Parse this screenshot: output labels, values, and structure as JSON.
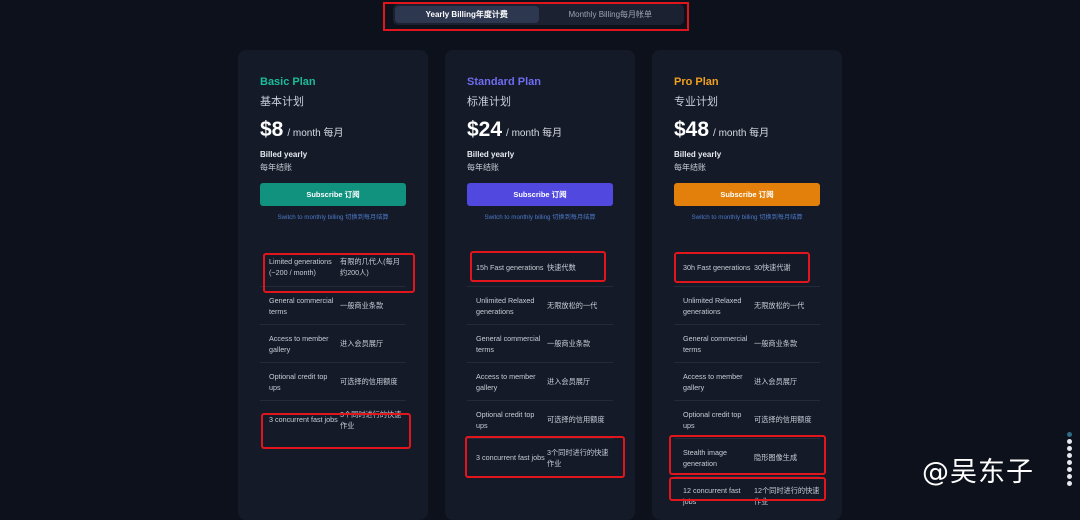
{
  "billing_toggle": {
    "yearly_label": "Yearly Billing年度计费",
    "monthly_label": "Monthly Billing每月帐单"
  },
  "plans": [
    {
      "name": "Basic Plan",
      "name_cn": "基本计划",
      "accent": "#1cbb9a",
      "price": "$8",
      "per": "/ month 每月",
      "billed": "Billed yearly",
      "billed_cn": "每年结账",
      "subscribe_label": "Subscribe 订阅",
      "button_color": "#11927f",
      "switch_label": "Switch to monthly billing 切换到每月结算",
      "features": [
        {
          "en": "Limited generations (~200 / month)",
          "cn": "有限的几代人(每月约200人)"
        },
        {
          "en": "General commercial terms",
          "cn": "一般商业条款"
        },
        {
          "en": "Access to member gallery",
          "cn": "进入会员展厅"
        },
        {
          "en": "Optional credit top ups",
          "cn": "可选择的信用额度"
        },
        {
          "en": "3 concurrent fast jobs",
          "cn": "3个同时进行的快速作业"
        }
      ]
    },
    {
      "name": "Standard Plan",
      "name_cn": "标准计划",
      "accent": "#6e6cf0",
      "price": "$24",
      "per": "/ month 每月",
      "billed": "Billed yearly",
      "billed_cn": "每年结账",
      "subscribe_label": "Subscribe 订阅",
      "button_color": "#5148e0",
      "switch_label": "Switch to monthly billing 切换到每月结算",
      "features": [
        {
          "en": "15h Fast generations",
          "cn": "快速代数"
        },
        {
          "en": "Unlimited Relaxed generations",
          "cn": "无限放松的一代"
        },
        {
          "en": "General commercial terms",
          "cn": "一般商业条款"
        },
        {
          "en": "Access to member gallery",
          "cn": "进入会员展厅"
        },
        {
          "en": "Optional credit top ups",
          "cn": "可选择的信用额度"
        },
        {
          "en": "3 concurrent fast jobs",
          "cn": "3个同时进行的快速作业"
        }
      ]
    },
    {
      "name": "Pro Plan",
      "name_cn": "专业计划",
      "accent": "#f0a020",
      "price": "$48",
      "per": "/ month 每月",
      "billed": "Billed yearly",
      "billed_cn": "每年结账",
      "subscribe_label": "Subscribe 订阅",
      "button_color": "#e3800b",
      "switch_label": "Switch to monthly billing 切换到每月结算",
      "features": [
        {
          "en": "30h Fast generations",
          "cn": "30快速代谢"
        },
        {
          "en": "Unlimited Relaxed generations",
          "cn": "无限放松的一代"
        },
        {
          "en": "General commercial terms",
          "cn": "一般商业条款"
        },
        {
          "en": "Access to member gallery",
          "cn": "进入会员展厅"
        },
        {
          "en": "Optional credit top ups",
          "cn": "可选择的信用额度"
        },
        {
          "en": "Stealth image generation",
          "cn": "隐形图像生成"
        },
        {
          "en": "12 concurrent fast jobs",
          "cn": "12个同时进行的快速作业"
        }
      ]
    }
  ],
  "watermark": "@吴东子"
}
